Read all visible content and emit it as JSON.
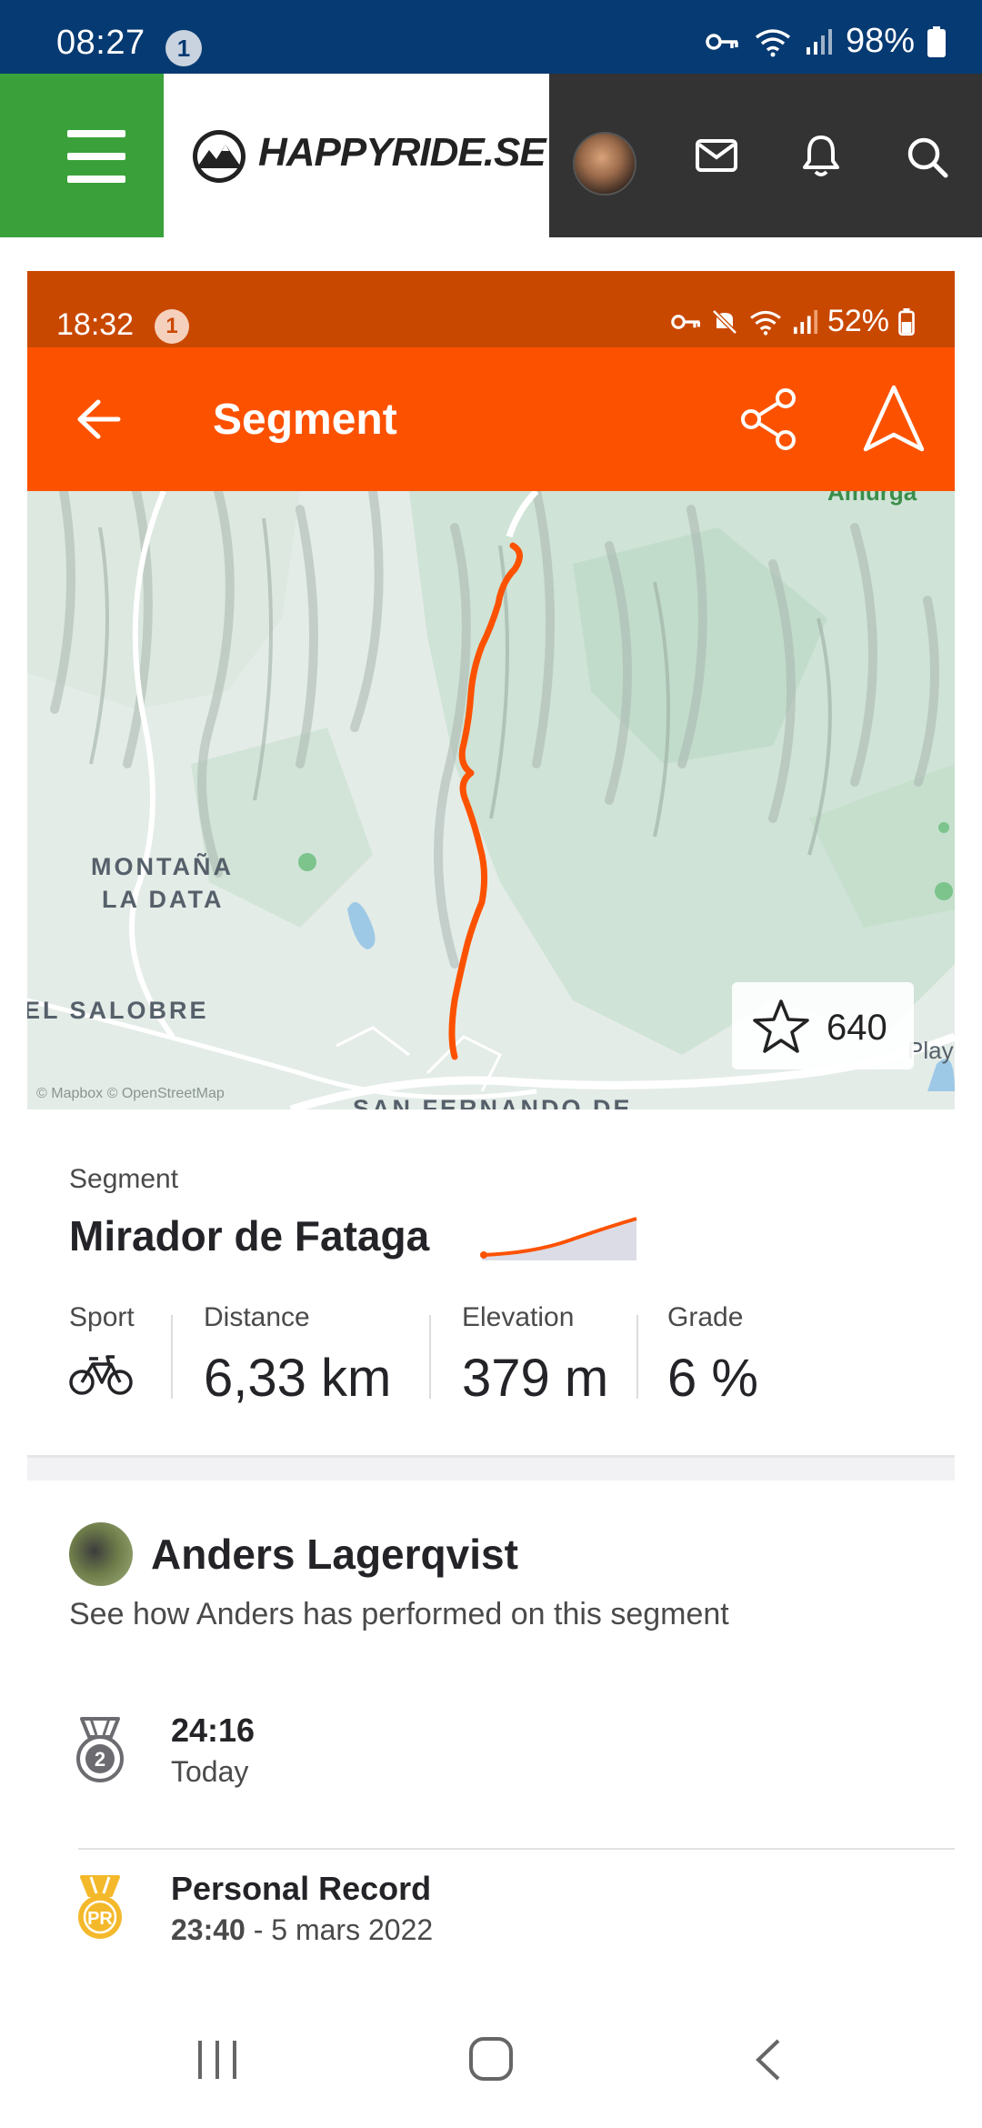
{
  "device_status": {
    "time": "08:27",
    "notification_count": "1",
    "battery": "98%"
  },
  "site_header": {
    "logo_text": "HAPPYRIDE.SE",
    "icons": [
      "menu-icon",
      "mail-icon",
      "bell-icon",
      "search-icon"
    ],
    "menu_color": "#3aa13a"
  },
  "screenshot_status": {
    "time": "18:32",
    "notification_count": "1",
    "battery": "52%"
  },
  "app_bar": {
    "title": "Segment",
    "accent": "#fc5200"
  },
  "map": {
    "labels": {
      "area1_line1": "MONTAÑA",
      "area1_line2": "LA DATA",
      "area2": "EL SALOBRE",
      "area3": "SAN FERNANDO DE",
      "top_right": "Amurga",
      "right_edge": "Play",
      "attribution": "© Mapbox © OpenStreetMap"
    },
    "star_count": "640",
    "route_color": "#fc5200"
  },
  "segment": {
    "kicker": "Segment",
    "name": "Mirador de Fataga",
    "stats": [
      {
        "label": "Sport",
        "icon": "bike-icon"
      },
      {
        "label": "Distance",
        "value": "6,33 km"
      },
      {
        "label": "Elevation",
        "value": "379 m"
      },
      {
        "label": "Grade",
        "value": "6 %"
      }
    ]
  },
  "athlete": {
    "name": "Anders Lagerqvist",
    "subtitle": "See how Anders has performed on this segment",
    "efforts": [
      {
        "medal": "2",
        "time": "24:16",
        "date": "Today"
      },
      {
        "medal": "PR",
        "title": "Personal Record",
        "time": "23:40",
        "date": " - 5 mars 2022"
      }
    ]
  }
}
